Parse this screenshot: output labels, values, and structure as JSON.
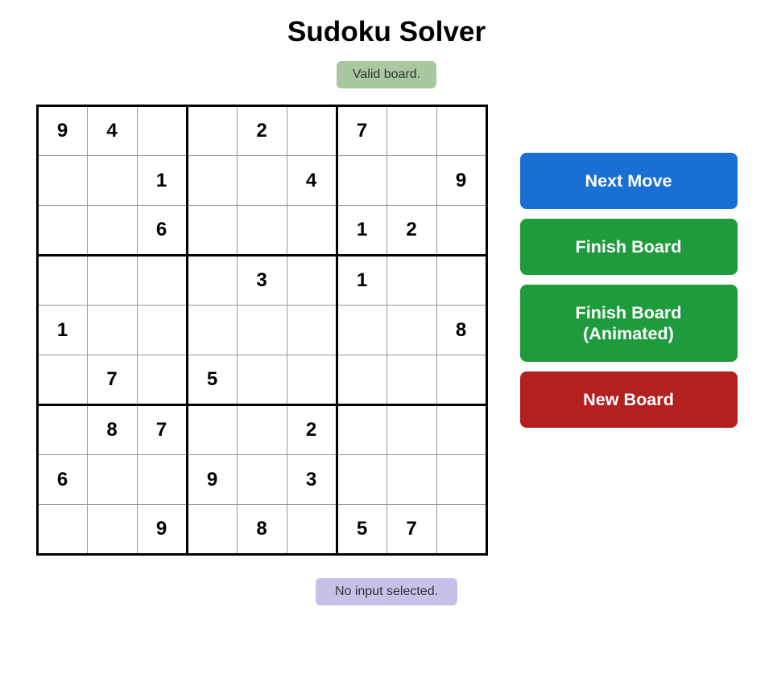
{
  "title": "Sudoku Solver",
  "status": "Valid board.",
  "bottom_status": "No input selected.",
  "buttons": {
    "next_move": "Next Move",
    "finish_board": "Finish Board",
    "finish_board_animated": "Finish Board (Animated)",
    "new_board": "New Board"
  },
  "grid": [
    [
      9,
      4,
      "",
      "",
      2,
      "",
      7,
      "",
      ""
    ],
    [
      "",
      "",
      1,
      "",
      "",
      4,
      "",
      "",
      9
    ],
    [
      "",
      "",
      6,
      "",
      "",
      "",
      1,
      2,
      ""
    ],
    [
      "",
      "",
      "",
      "",
      3,
      "",
      1,
      "",
      ""
    ],
    [
      1,
      "",
      "",
      "",
      "",
      "",
      "",
      "",
      8
    ],
    [
      "",
      7,
      "",
      5,
      "",
      "",
      "",
      "",
      ""
    ],
    [
      "",
      8,
      7,
      "",
      "",
      2,
      "",
      "",
      ""
    ],
    [
      6,
      "",
      "",
      9,
      "",
      3,
      "",
      "",
      ""
    ],
    [
      "",
      "",
      9,
      "",
      8,
      "",
      5,
      7,
      ""
    ]
  ]
}
